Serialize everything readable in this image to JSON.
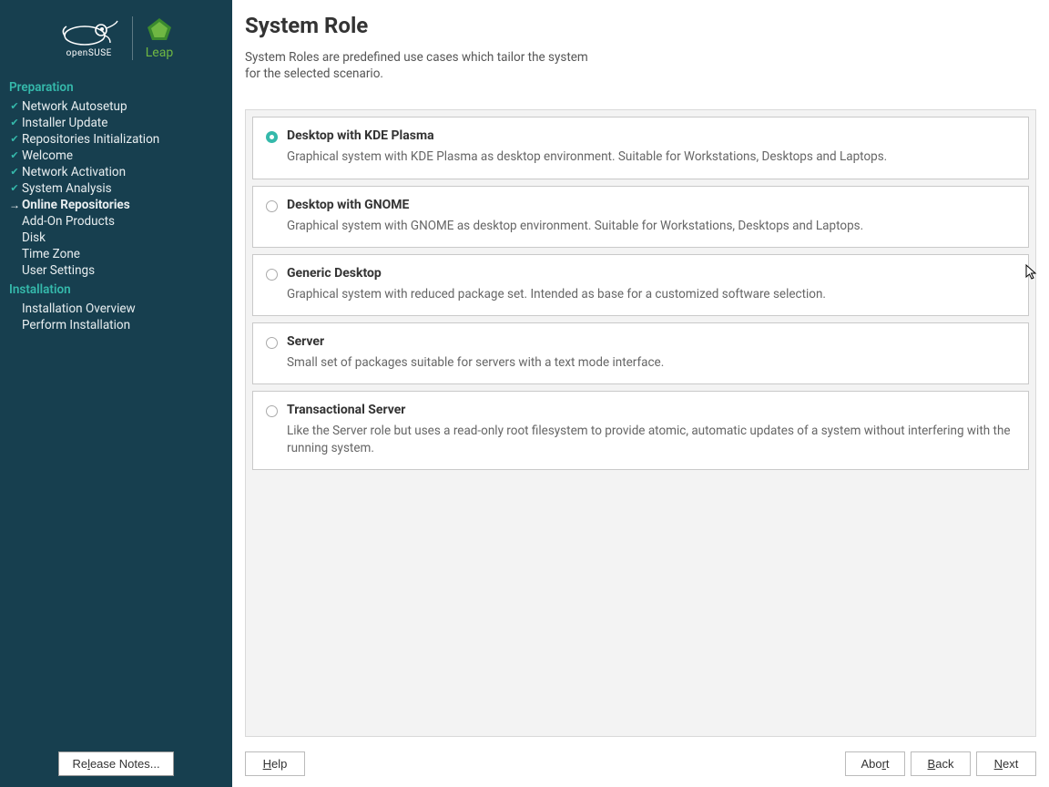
{
  "brand": {
    "opensuse": "openSUSE",
    "leap": "Leap"
  },
  "sidebar": {
    "sections": [
      {
        "title": "Preparation",
        "items": [
          {
            "label": "Network Autosetup",
            "state": "done"
          },
          {
            "label": "Installer Update",
            "state": "done"
          },
          {
            "label": "Repositories Initialization",
            "state": "done"
          },
          {
            "label": "Welcome",
            "state": "done"
          },
          {
            "label": "Network Activation",
            "state": "done"
          },
          {
            "label": "System Analysis",
            "state": "done"
          },
          {
            "label": "Online Repositories",
            "state": "current"
          },
          {
            "label": "Add-On Products",
            "state": "todo"
          },
          {
            "label": "Disk",
            "state": "todo"
          },
          {
            "label": "Time Zone",
            "state": "todo"
          },
          {
            "label": "User Settings",
            "state": "todo"
          }
        ]
      },
      {
        "title": "Installation",
        "items": [
          {
            "label": "Installation Overview",
            "state": "todo"
          },
          {
            "label": "Perform Installation",
            "state": "todo"
          }
        ]
      }
    ],
    "release_notes_label": "Release Notes...",
    "release_notes_mnemonic_index": 2
  },
  "page": {
    "title": "System Role",
    "description": "System Roles are predefined use cases which tailor the system\nfor the selected scenario.",
    "roles": [
      {
        "title": "Desktop with KDE Plasma",
        "desc": "Graphical system with KDE Plasma as desktop environment. Suitable for Workstations, Desktops and Laptops.",
        "selected": true
      },
      {
        "title": "Desktop with GNOME",
        "desc": "Graphical system with GNOME as desktop environment. Suitable for Workstations, Desktops and Laptops.",
        "selected": false
      },
      {
        "title": "Generic Desktop",
        "desc": "Graphical system with reduced package set. Intended as base for a customized software selection.",
        "selected": false
      },
      {
        "title": "Server",
        "desc": "Small set of packages suitable for servers with a text mode interface.",
        "selected": false
      },
      {
        "title": "Transactional Server",
        "desc": "Like the Server role but uses a read-only root filesystem to provide atomic, automatic updates of a system without interfering with the running system.",
        "selected": false
      }
    ]
  },
  "buttons": {
    "help": "Help",
    "abort": "Abort",
    "back": "Back",
    "next": "Next"
  },
  "colors": {
    "sidebar_bg": "#173f4f",
    "accent": "#35b9ab",
    "leap_green": "#6fb743"
  }
}
